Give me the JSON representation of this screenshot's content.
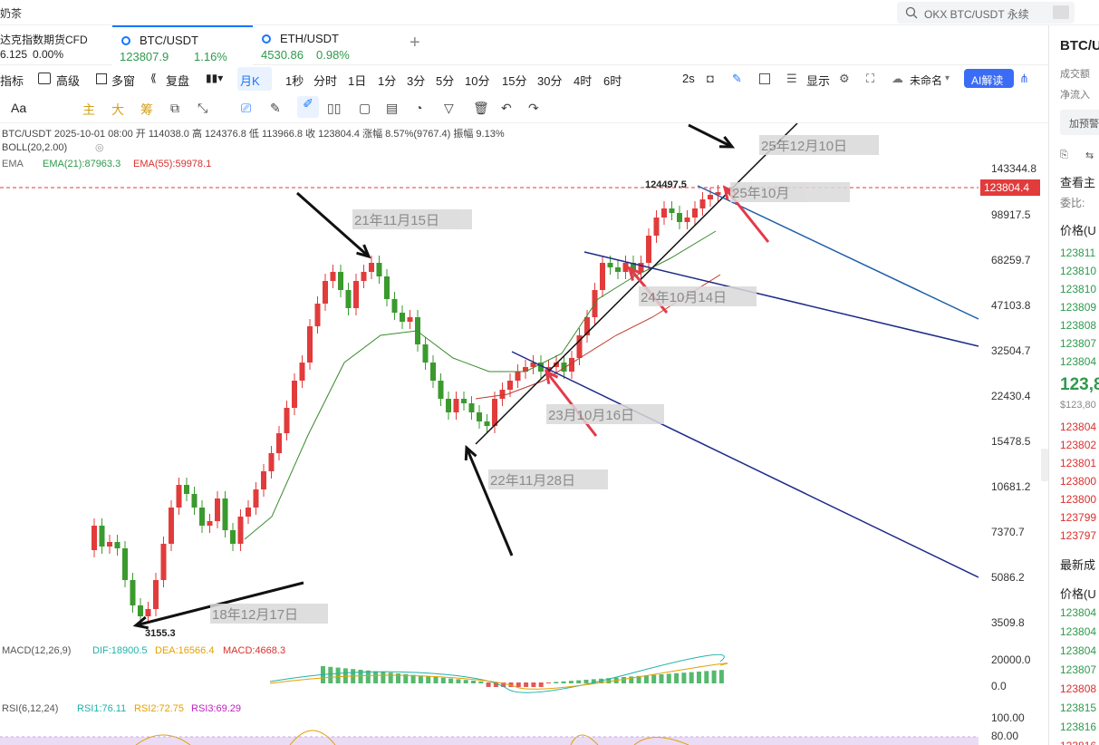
{
  "window": {
    "title": "奶茶"
  },
  "search": {
    "placeholder": "OKX BTC/USDT 永续"
  },
  "tabs": [
    {
      "name": "达克指数期货CFD",
      "value": "6.125",
      "change": "0.00%"
    },
    {
      "name": "BTC/USDT",
      "value": "123807.9",
      "change": "1.16%"
    },
    {
      "name": "ETH/USDT",
      "value": "4530.86",
      "change": "0.98%"
    }
  ],
  "tab_add": "+",
  "toolbar1": {
    "indicators": "指标",
    "advanced": "高级",
    "multi": "多窗",
    "replay": "复盘",
    "period": "月K",
    "t1": "1秒",
    "t2": "分时",
    "t3": "1日",
    "t4": "1分",
    "t5": "3分",
    "t6": "5分",
    "t7": "10分",
    "t8": "15分",
    "t9": "30分",
    "t10": "4时",
    "t11": "6时",
    "refresh": "2s",
    "display": "显示",
    "unnamed": "未命名",
    "ai": "AI解读"
  },
  "toolbar2": {
    "aa": "Aa",
    "main": "主",
    "big": "大",
    "chip": "筹"
  },
  "info": {
    "line1": "BTC/USDT  2025-10-01 08:00  开 114038.0  高 124376.8  低 113966.8  收 123804.4  涨幅 8.57%(9767.4)  振幅 9.13%",
    "boll": "BOLL(20,2.00)",
    "ema": "EMA",
    "ema21": "EMA(21):87963.3",
    "ema55": "EMA(55):59978.1",
    "macd": "MACD(12,26,9)",
    "dif": "DIF:18900.5",
    "dea": "DEA:16566.4",
    "macdv": "MACD:4668.3",
    "rsi": "RSI(6,12,24)",
    "rsi1": "RSI1:76.11",
    "rsi2": "RSI2:72.75",
    "rsi3": "RSI3:69.29"
  },
  "price_scale": [
    "143344.8",
    "98917.5",
    "68259.7",
    "47103.8",
    "32504.7",
    "22430.4",
    "15478.5",
    "10681.2",
    "7370.7",
    "5086.2",
    "3509.8"
  ],
  "current_price": "123804.4",
  "macd_scale": [
    "20000.0",
    "0.0"
  ],
  "rsi_scale": [
    "100.00",
    "80.00"
  ],
  "marks": {
    "high": "124497.5",
    "low": "3155.3"
  },
  "annotations": [
    "25年12月10日",
    "25年10月",
    "21年11月15日",
    "24年10月14日",
    "23月10月16日",
    "22年11月28日",
    "18年12月17日"
  ],
  "colors": {
    "up": "#e23b3b",
    "down": "#3a9a2e",
    "accent": "#1677ff"
  },
  "right_panel": {
    "symbol": "BTC/U",
    "vol": "成交额",
    "inflow": "净流入",
    "alert": "加预警",
    "view": "查看主",
    "ratio": "委比:",
    "price_header": "价格(U",
    "asks": [
      "123811",
      "123810",
      "123810",
      "123809",
      "123808",
      "123807",
      "123804"
    ],
    "mid": "123,8",
    "mid_sub": "$123,80",
    "bids": [
      "123804",
      "123802",
      "123801",
      "123800",
      "123800",
      "123799",
      "123797"
    ],
    "latest": "最新成",
    "price_header2": "价格(U",
    "trades": [
      "123804",
      "123804",
      "123804",
      "123807",
      "123808",
      "123815",
      "123816",
      "123816"
    ]
  }
}
